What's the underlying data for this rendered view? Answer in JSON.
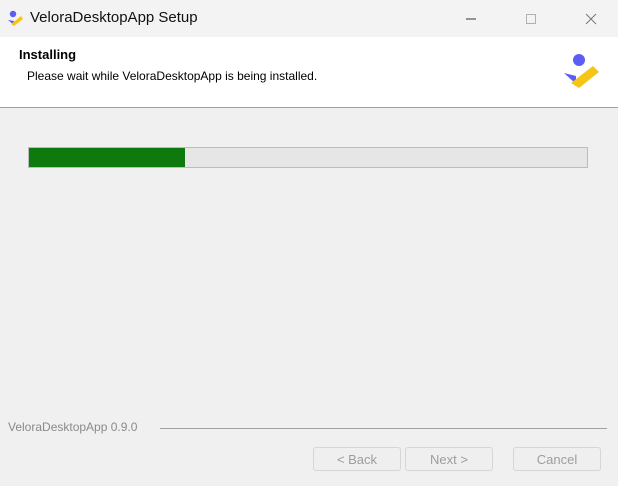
{
  "window": {
    "title": "VeloraDesktopApp Setup",
    "icons": {
      "app": "velora-logo-icon",
      "minimize": "minimize-icon",
      "maximize": "maximize-icon",
      "close": "close-icon"
    }
  },
  "header": {
    "title": "Installing",
    "subtitle": "Please wait while VeloraDesktopApp is being installed.",
    "logo_icon": "velora-logo-icon"
  },
  "progress": {
    "value_fraction": 0.28,
    "color": "#0e7a0d"
  },
  "footer": {
    "brand_text": "VeloraDesktopApp 0.9.0",
    "back_label": "< Back",
    "next_label": "Next >",
    "cancel_label": "Cancel"
  },
  "colors": {
    "logo_purple": "#5b5ef0",
    "logo_yellow": "#f5c518"
  }
}
